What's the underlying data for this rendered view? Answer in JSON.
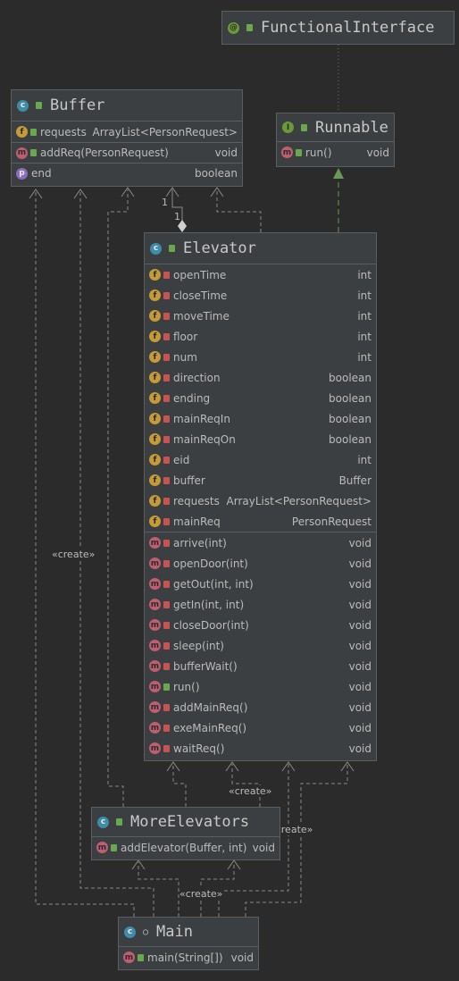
{
  "functional_interface": {
    "name": "FunctionalInterface",
    "icon": "annotation-icon"
  },
  "runnable": {
    "name": "Runnable",
    "methods": [
      {
        "name": "run()",
        "type": "void"
      }
    ]
  },
  "buffer": {
    "name": "Buffer",
    "fields": [
      {
        "name": "requests",
        "type": "ArrayList<PersonRequest>"
      }
    ],
    "methods": [
      {
        "name": "addReq(PersonRequest)",
        "type": "void"
      }
    ],
    "properties": [
      {
        "name": "end",
        "type": "boolean"
      }
    ]
  },
  "elevator": {
    "name": "Elevator",
    "fields": [
      {
        "name": "openTime",
        "type": "int"
      },
      {
        "name": "closeTime",
        "type": "int"
      },
      {
        "name": "moveTime",
        "type": "int"
      },
      {
        "name": "floor",
        "type": "int"
      },
      {
        "name": "num",
        "type": "int"
      },
      {
        "name": "direction",
        "type": "boolean"
      },
      {
        "name": "ending",
        "type": "boolean"
      },
      {
        "name": "mainReqIn",
        "type": "boolean"
      },
      {
        "name": "mainReqOn",
        "type": "boolean"
      },
      {
        "name": "eid",
        "type": "int"
      },
      {
        "name": "buffer",
        "type": "Buffer"
      },
      {
        "name": "requests",
        "type": "ArrayList<PersonRequest>"
      },
      {
        "name": "mainReq",
        "type": "PersonRequest"
      }
    ],
    "methods": [
      {
        "name": "arrive(int)",
        "type": "void"
      },
      {
        "name": "openDoor(int)",
        "type": "void"
      },
      {
        "name": "getOut(int, int)",
        "type": "void"
      },
      {
        "name": "getIn(int, int)",
        "type": "void"
      },
      {
        "name": "closeDoor(int)",
        "type": "void"
      },
      {
        "name": "sleep(int)",
        "type": "void"
      },
      {
        "name": "bufferWait()",
        "type": "void"
      },
      {
        "name": "run()",
        "type": "void"
      },
      {
        "name": "addMainReq()",
        "type": "void"
      },
      {
        "name": "exeMainReq()",
        "type": "void"
      },
      {
        "name": "waitReq()",
        "type": "void"
      }
    ]
  },
  "more_elevators": {
    "name": "MoreElevators",
    "methods": [
      {
        "name": "addElevator(Buffer, int)",
        "type": "void"
      }
    ]
  },
  "main": {
    "name": "Main",
    "methods": [
      {
        "name": "main(String[])",
        "type": "void"
      }
    ]
  },
  "labels": {
    "create": "«create»",
    "one_a": "1",
    "one_b": "1"
  },
  "colors": {
    "background": "#2b2b2b",
    "box": "#3c3f41",
    "edge": "#8a8a8a",
    "implements": "#6a9955",
    "private": "#c75450",
    "public": "#6aa84f"
  }
}
